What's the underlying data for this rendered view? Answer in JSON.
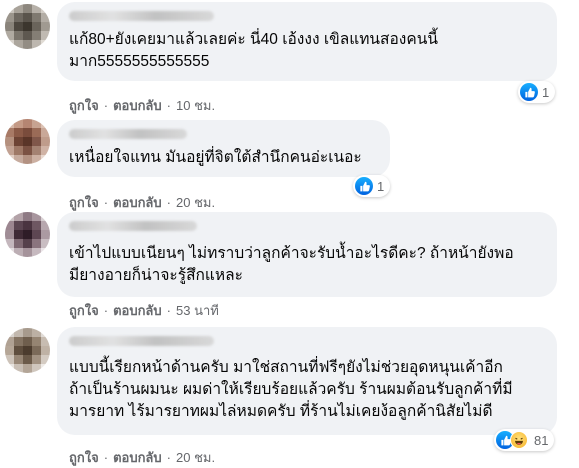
{
  "comments": [
    {
      "text": "แก้80+ยังเคยมาแล้วเลยค่ะ นี่40 เอ้งงง เขิลแทนสองคนนี้\nมาก5555555555555",
      "like_label": "ถูกใจ",
      "reply_label": "ตอบกลับ",
      "time": "10 ชม.",
      "reactions": {
        "count": "1",
        "icons": [
          "like-icon"
        ]
      },
      "avatar_colors": [
        "#c9c4bd",
        "#a9a39a",
        "#8d877e",
        "#b6b0a8",
        "#d2cdc6",
        "#9b958c",
        "#6e6860",
        "#5a544c",
        "#7f7970",
        "#b3ada5",
        "#8a847b",
        "#4d473f",
        "#3c362e",
        "#6a645b",
        "#a09a91",
        "#b0aaa1",
        "#7a746b",
        "#5e5850",
        "#847e75",
        "#c0bab2",
        "#d8d3cc",
        "#aca69d",
        "#938d84",
        "#bdb7af",
        "#e0dbd4"
      ]
    },
    {
      "text": "เหนื่อยใจแทน มันอยู่ที่จิตใต้สำนึกคนอ่ะเนอะ",
      "like_label": "ถูกใจ",
      "reply_label": "ตอบกลับ",
      "time": "20 ชม.",
      "reactions": {
        "count": "1",
        "icons": [
          "like-icon"
        ]
      },
      "avatar_colors": [
        "#d6b8a8",
        "#c49a86",
        "#b58572",
        "#c7a391",
        "#dcc2b4",
        "#a87a66",
        "#8b5a47",
        "#7a4c3c",
        "#9a6b57",
        "#c9a898",
        "#b4907e",
        "#6d4334",
        "#5a3528",
        "#80574a",
        "#bf9c8b",
        "#c2a293",
        "#9e7866",
        "#7b5243",
        "#a48272",
        "#d0b3a5",
        "#e2cfc5",
        "#c6ab9e",
        "#b39282",
        "#ccb0a2",
        "#e8d8cf"
      ]
    },
    {
      "text": "เข้าไปแบบเนียนๆ ไม่ทราบว่าลูกค้าจะรับน้ำอะไรดีคะ? ถ้าหน้ายังพอ\nมียางอายก็น่าจะรู้สึกแหละ",
      "like_label": "ถูกใจ",
      "reply_label": "ตอบกลับ",
      "time": "53 นาที",
      "reactions": null,
      "avatar_colors": [
        "#cfc6c8",
        "#b3a2a8",
        "#8e7a84",
        "#a8969e",
        "#d8d0d3",
        "#9c8690",
        "#5b4551",
        "#4a3440",
        "#6e5762",
        "#b7a7ae",
        "#a08d96",
        "#3f2a36",
        "#2e1c27",
        "#5d4652",
        "#ab9aa2",
        "#c4b7bd",
        "#7e6872",
        "#55404b",
        "#8a747e",
        "#c9bdc2",
        "#e3dcdf",
        "#bcaeb4",
        "#a5939b",
        "#c6b9bf",
        "#ebe5e8"
      ]
    },
    {
      "text": "แบบนี้เรียกหน้าด้านครับ มาใช่สถานที่ฟรีๆยังไม่ช่วยอุดหนุนเค้าอีก\nถ้าเป็นร้านผมนะ ผมด่าให้เรียบร้อยแล้วครับ ร้านผมต้อนรับลูกค้าที่มี\nมารยาท ไร้มารยาทผมไล่หมดครับ ที่ร้านไม่เคยง้อลูกค้านิสัยไม่ดี",
      "like_label": "ถูกใจ",
      "reply_label": "ตอบกลับ",
      "time": "20 ชม.",
      "reactions": {
        "count": "81",
        "icons": [
          "like-icon",
          "haha-icon"
        ]
      },
      "avatar_colors": [
        "#d9d4cf",
        "#c2b8ae",
        "#a79a8d",
        "#bcb0a4",
        "#e0dbd6",
        "#b0a193",
        "#847362",
        "#6f5e4d",
        "#958472",
        "#c7bcb1",
        "#b5a697",
        "#5f4e3e",
        "#4c3c2e",
        "#7b6a59",
        "#bfb2a5",
        "#cdc3b9",
        "#978675",
        "#6b5a49",
        "#a29282",
        "#d4cbc2",
        "#e8e4e0",
        "#c9bfb5",
        "#b3a597",
        "#d0c7be",
        "#efebe7"
      ]
    }
  ]
}
